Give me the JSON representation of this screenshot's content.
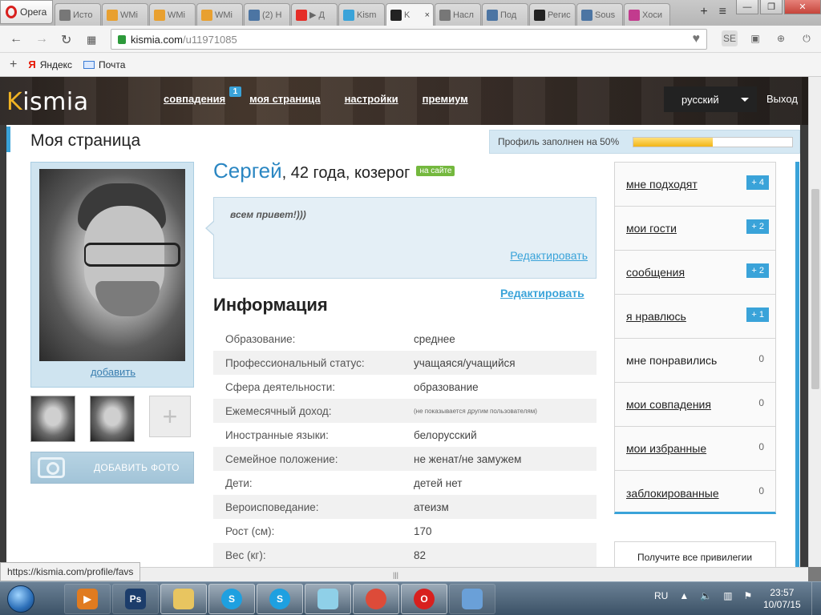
{
  "browser": {
    "menu_label": "Opera",
    "tabs": [
      {
        "title": "Исто",
        "favicon": "clock-icon",
        "color": "#777777",
        "active": false
      },
      {
        "title": "WMi",
        "favicon": "coin-icon",
        "color": "#e8a030",
        "active": false
      },
      {
        "title": "WMi",
        "favicon": "coin-icon",
        "color": "#e8a030",
        "active": false
      },
      {
        "title": "WMi",
        "favicon": "coin-icon",
        "color": "#e8a030",
        "active": false
      },
      {
        "title": "(2) Н",
        "favicon": "vk-icon",
        "color": "#4c75a3",
        "active": false
      },
      {
        "title": "▶ Д",
        "favicon": "youtube-icon",
        "color": "#e52d27",
        "active": false
      },
      {
        "title": "Kism",
        "favicon": "kismia-ring-icon",
        "color": "#3aa3d9",
        "active": false
      },
      {
        "title": "K",
        "favicon": "kismia-k-icon",
        "color": "#222222",
        "active": true,
        "close": "×"
      },
      {
        "title": "Насл",
        "favicon": "gear-icon",
        "color": "#777777",
        "active": false
      },
      {
        "title": "Под",
        "favicon": "vk-icon",
        "color": "#4c75a3",
        "active": false
      },
      {
        "title": "Регис",
        "favicon": "kismia-k-icon",
        "color": "#222222",
        "active": false
      },
      {
        "title": "Sous",
        "favicon": "vk-icon",
        "color": "#4c75a3",
        "active": false
      },
      {
        "title": "Хоси",
        "favicon": "k-purple-icon",
        "color": "#c23b8e",
        "active": false
      }
    ],
    "new_tab": "+",
    "tab_list": "≡",
    "address": {
      "host": "kismia.com",
      "path": "/u11971085"
    },
    "bookmarks": [
      {
        "label": "Яндекс",
        "icon": "yandex-icon"
      },
      {
        "label": "Почта",
        "icon": "mail-icon"
      }
    ],
    "status_url": "https://kismia.com/profile/favs"
  },
  "site": {
    "logo": {
      "first": "K",
      "rest": "ismia"
    },
    "nav": [
      {
        "label": "совпадения",
        "badge": "1"
      },
      {
        "label": "моя страница"
      },
      {
        "label": "настройки"
      },
      {
        "label": "премиум"
      }
    ],
    "language": "русский",
    "logout": "Выход"
  },
  "page": {
    "title": "Моя страница",
    "profile_fill_label": "Профиль заполнен на 50%",
    "profile_fill_fraction": 0.5,
    "photo": {
      "add_link": "добавить",
      "add_photo_button": "ДОБАВИТЬ ФОТО"
    },
    "profile": {
      "name": "Сергей",
      "details": ", 42 года, козерог",
      "online_badge": "на сайте",
      "about": "всем привет!)))",
      "about_edit": "Редактировать"
    },
    "info": {
      "title": "Информация",
      "edit": "Редактировать",
      "rows": [
        {
          "label": "Образование:",
          "value": "среднее"
        },
        {
          "label": "Профессиональный статус:",
          "value": "учащаяся/учащийся"
        },
        {
          "label": "Сфера деятельности:",
          "value": "образование"
        },
        {
          "label": "Ежемесячный доход:",
          "value": "(не показывается другим пользователям)"
        },
        {
          "label": "Иностранные языки:",
          "value": "белорусский"
        },
        {
          "label": "Семейное положение:",
          "value": "не женат/не замужем"
        },
        {
          "label": "Дети:",
          "value": "детей нет"
        },
        {
          "label": "Вероисповедание:",
          "value": "атеизм"
        },
        {
          "label": "Рост (см):",
          "value": "170"
        },
        {
          "label": "Вес (кг):",
          "value": "82"
        }
      ]
    },
    "side_menu": [
      {
        "label": "мне подходят",
        "count": "+ 4",
        "link": true
      },
      {
        "label": "мои гости",
        "count": "+ 2",
        "link": true
      },
      {
        "label": "сообщения",
        "count": "+ 2",
        "link": true
      },
      {
        "label": "я нравлюсь",
        "count": "+ 1",
        "link": true
      },
      {
        "label": "мне понравились",
        "count": "0",
        "link": false
      },
      {
        "label": "мои совпадения",
        "count": "0",
        "link": true
      },
      {
        "label": "мои избранные",
        "count": "0",
        "link": true
      },
      {
        "label": "заблокированные",
        "count": "0",
        "link": true
      }
    ],
    "promo_text": "Получите все привилегии"
  },
  "taskbar": {
    "apps": [
      {
        "name": "media-player-icon",
        "label": "▶",
        "color": "#e07b20"
      },
      {
        "name": "photoshop-icon",
        "label": "Ps",
        "color": "#1c3d6b"
      },
      {
        "name": "folder-icon",
        "label": "",
        "color": "#e8c560"
      },
      {
        "name": "skype-icon",
        "label": "S",
        "color": "#1ea0e0"
      },
      {
        "name": "skype-icon",
        "label": "S",
        "color": "#1ea0e0"
      },
      {
        "name": "notepad-icon",
        "label": "",
        "color": "#8fd0e8"
      },
      {
        "name": "chrome-icon",
        "label": "",
        "color": "#dd4b39"
      },
      {
        "name": "opera-icon",
        "label": "O",
        "color": "#d8201e"
      },
      {
        "name": "paint-icon",
        "label": "",
        "color": "#6aa0d8"
      }
    ],
    "lang": "RU",
    "time": "23:57",
    "date": "10/07/15"
  }
}
